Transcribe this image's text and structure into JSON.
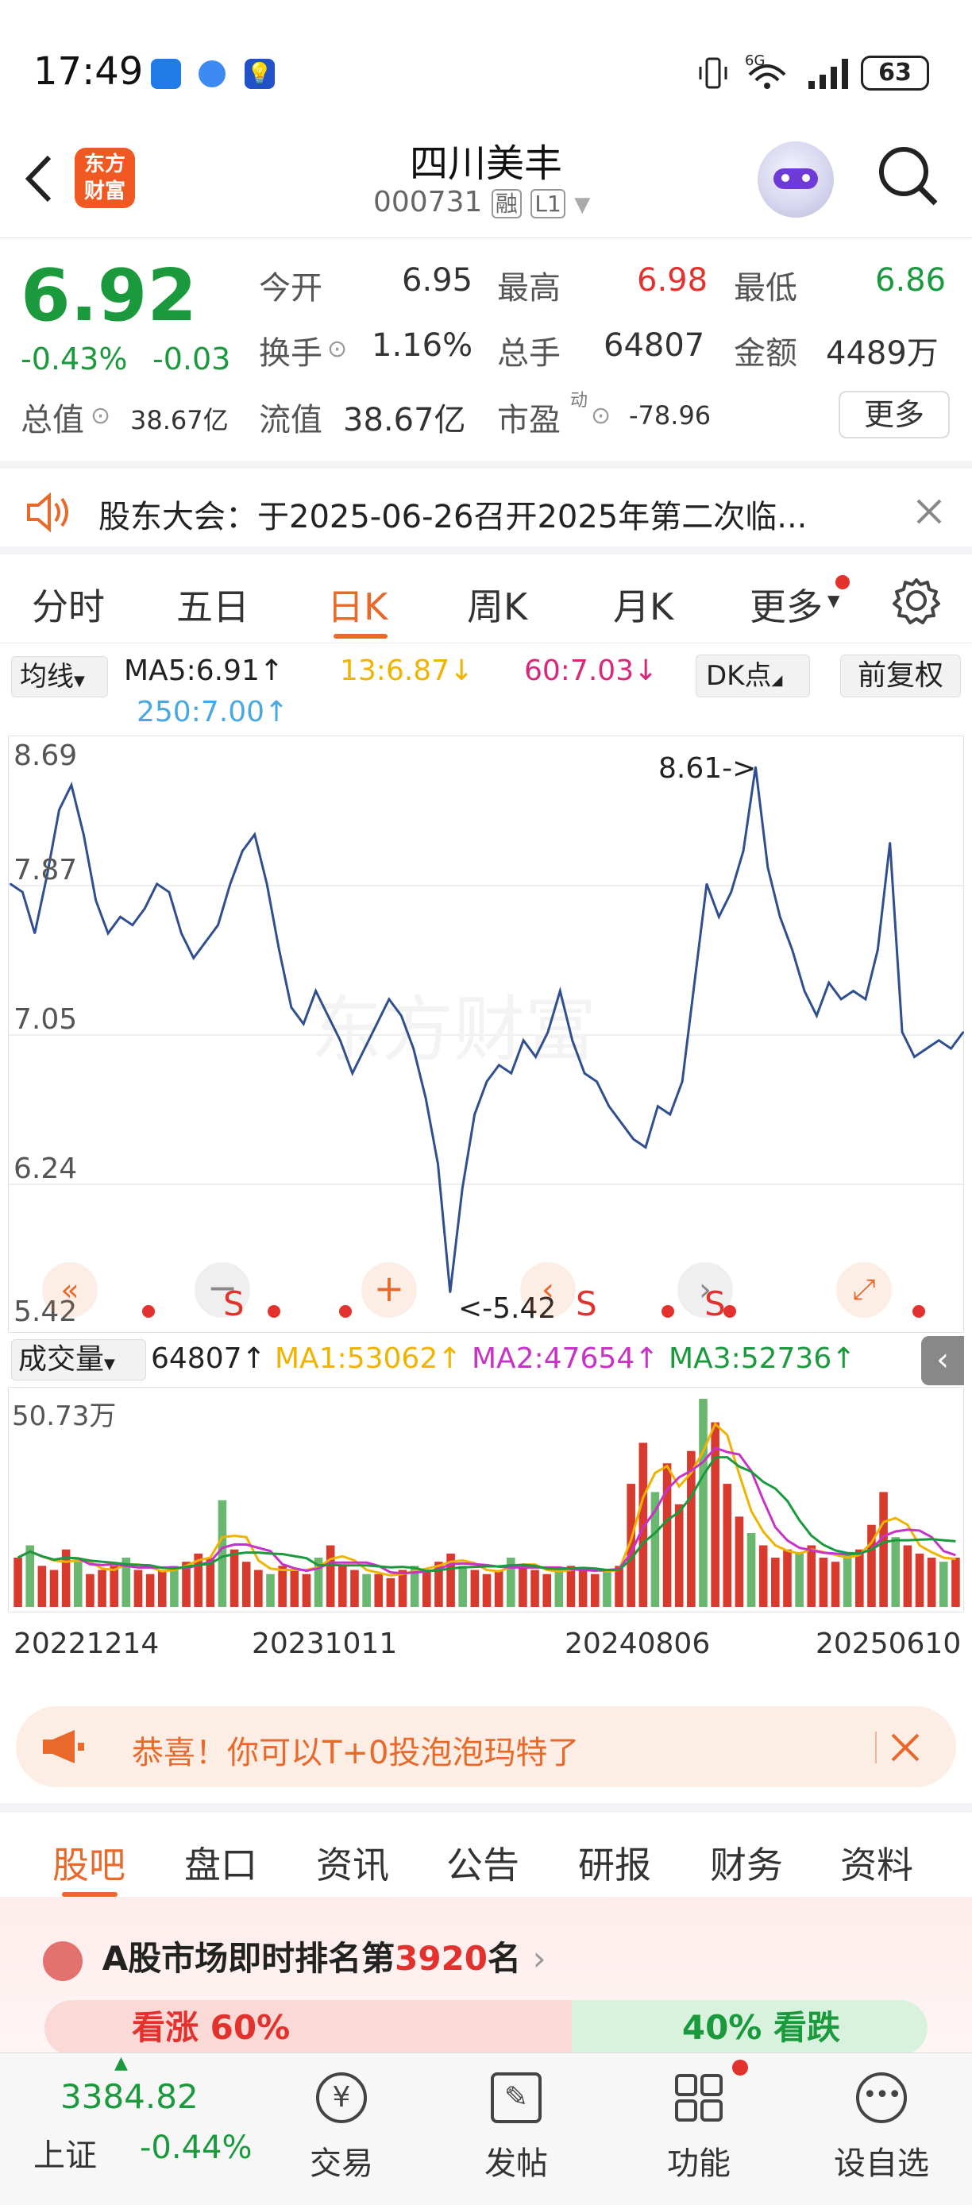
{
  "status_bar": {
    "time": "17:49",
    "network": "6G",
    "battery": "63"
  },
  "header": {
    "title": "四川美丰",
    "code": "000731",
    "badge_rong": "融",
    "badge_level": "L1"
  },
  "quote": {
    "price": "6.92",
    "change_pct": "-0.43%",
    "change": "-0.03",
    "open_label": "今开",
    "open": "6.95",
    "high_label": "最高",
    "high": "6.98",
    "low_label": "最低",
    "low": "6.86",
    "turnover_label": "换手",
    "turnover": "1.16%",
    "volume_label": "总手",
    "volume": "64807",
    "amount_label": "金额",
    "amount": "4489万",
    "total_mv_label": "总值",
    "total_mv": "38.67亿",
    "float_mv_label": "流值",
    "float_mv": "38.67亿",
    "pe_label": "市盈",
    "pe_sup": "动",
    "pe": "-78.96",
    "more_button": "更多"
  },
  "notice": {
    "text": "股东大会：于2025-06-26召开2025年第二次临..."
  },
  "chart_tabs": [
    "分时",
    "五日",
    "日K",
    "周K",
    "月K",
    "更多"
  ],
  "ma_bar": {
    "selector": "均线",
    "ma5": "MA5:6.91↑",
    "ma13": "13:6.87↓",
    "ma60": "60:7.03↓",
    "ma250": "250:7.00↑",
    "dk_button": "DK点",
    "fq_button": "前复权",
    "colors": {
      "ma13": "#f0b400",
      "ma60": "#d9287a",
      "ma250": "#4aa8e0"
    }
  },
  "price_axis": [
    "8.69",
    "7.87",
    "7.05",
    "6.24",
    "5.42"
  ],
  "annotations": {
    "max_label": "8.61->",
    "min_label": "<-5.42",
    "sell_marker": "S"
  },
  "volume_bar": {
    "selector": "成交量",
    "vol": "64807↑",
    "ma1": "MA1:53062↑",
    "ma2": "MA2:47654↑",
    "ma3": "MA3:52736↑",
    "max_label": "50.73万"
  },
  "date_axis": [
    "20221214",
    "20231011",
    "20240806",
    "20250610"
  ],
  "chart_data": {
    "type": "line",
    "title": "",
    "ylim": [
      5.42,
      8.69
    ],
    "x": [
      "20221214",
      "20231011",
      "20240806",
      "20250610"
    ],
    "series": [
      {
        "values": [
          7.9,
          7.85,
          7.6,
          7.95,
          8.35,
          8.5,
          8.2,
          7.8,
          7.6,
          7.7,
          7.65,
          7.75,
          7.9,
          7.85,
          7.6,
          7.45,
          7.55,
          7.65,
          7.9,
          8.1,
          8.2,
          7.9,
          7.5,
          7.15,
          7.05,
          7.25,
          7.1,
          6.95,
          6.75,
          6.9,
          7.05,
          7.2,
          7.1,
          6.9,
          6.6,
          6.2,
          5.42,
          6.05,
          6.5,
          6.7,
          6.8,
          6.75,
          6.95,
          6.85,
          7.0,
          7.25,
          6.95,
          6.75,
          6.7,
          6.55,
          6.45,
          6.35,
          6.3,
          6.55,
          6.5,
          6.7,
          7.3,
          7.9,
          7.7,
          7.85,
          8.1,
          8.61,
          8.0,
          7.7,
          7.5,
          7.25,
          7.1,
          7.3,
          7.2,
          7.25,
          7.2,
          7.5,
          8.15,
          7.0,
          6.85,
          6.9,
          6.95,
          6.9,
          7.0
        ]
      },
      {
        "name": "成交量",
        "values": [
          12,
          15,
          10,
          9,
          14,
          11,
          8,
          9,
          10,
          12,
          9,
          8,
          9,
          10,
          11,
          13,
          12,
          26,
          14,
          11,
          9,
          8,
          10,
          9,
          8,
          12,
          15,
          10,
          9,
          8,
          8,
          7,
          9,
          10,
          9,
          11,
          13,
          10,
          9,
          8,
          9,
          12,
          10,
          9,
          8,
          9,
          10,
          9,
          8,
          9,
          10,
          30,
          40,
          28,
          35,
          25,
          38,
          50.73,
          45,
          30,
          22,
          18,
          15,
          12,
          14,
          13,
          15,
          12,
          11,
          13,
          14,
          20,
          28,
          17,
          15,
          13,
          12,
          11,
          12
        ]
      }
    ]
  },
  "promo": {
    "text": "恭喜！你可以T+0投泡泡玛特了"
  },
  "section_tabs": [
    "股吧",
    "盘口",
    "资讯",
    "公告",
    "研报",
    "财务",
    "资料"
  ],
  "rank": {
    "prefix": "A股市场即时排名第",
    "number": "3920",
    "suffix": "名"
  },
  "vote": {
    "up": "看涨 60%",
    "down": "40% 看跌"
  },
  "bottom_nav": {
    "index_value": "3384.82",
    "index_name": "上证",
    "index_change": "-0.44%",
    "items": [
      "交易",
      "发帖",
      "功能",
      "设自选"
    ]
  }
}
